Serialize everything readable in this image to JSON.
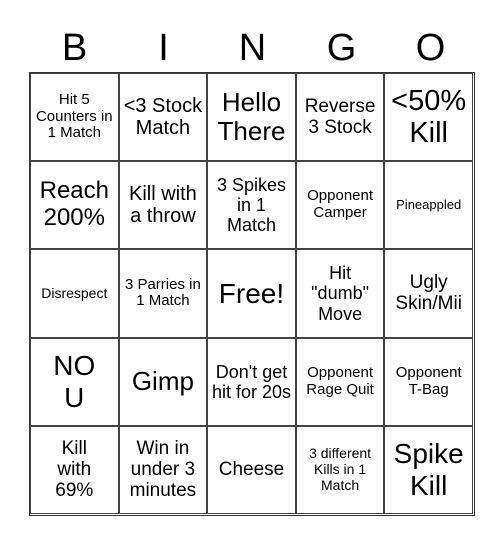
{
  "header": {
    "letters": [
      "B",
      "I",
      "N",
      "G",
      "O"
    ]
  },
  "board": {
    "cells": [
      "Hit 5 Counters in 1 Match",
      "<3 Stock Match",
      "Hello There",
      "Reverse 3 Stock",
      "<50% Kill",
      "Reach 200%",
      "Kill with a throw",
      "3 Spikes in 1 Match",
      "Opponent Camper",
      "Pineappled",
      "Disrespect",
      "3 Parries in 1 Match",
      "Free!",
      "Hit \"dumb\" Move",
      "Ugly Skin/Mii",
      "NO U",
      "Gimp",
      "Don't get hit for 20s",
      "Opponent Rage Quit",
      "Opponent T-Bag",
      "Kill with 69%",
      "Win in under 3 minutes",
      "Cheese",
      "3 different Kills in 1 Match",
      "Spike Kill"
    ]
  }
}
